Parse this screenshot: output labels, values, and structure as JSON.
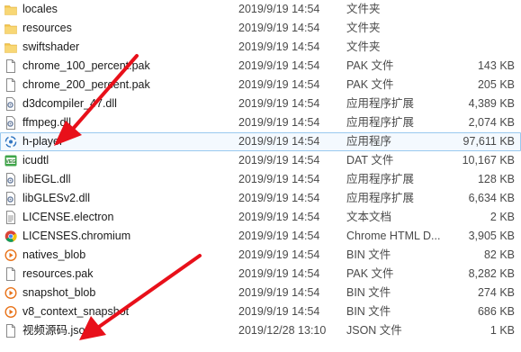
{
  "files": [
    {
      "name": "locales",
      "date": "2019/9/19 14:54",
      "type": "文件夹",
      "size": "",
      "icon": "folder-icon"
    },
    {
      "name": "resources",
      "date": "2019/9/19 14:54",
      "type": "文件夹",
      "size": "",
      "icon": "folder-icon"
    },
    {
      "name": "swiftshader",
      "date": "2019/9/19 14:54",
      "type": "文件夹",
      "size": "",
      "icon": "folder-icon"
    },
    {
      "name": "chrome_100_percent.pak",
      "date": "2019/9/19 14:54",
      "type": "PAK 文件",
      "size": "143 KB",
      "icon": "file-icon"
    },
    {
      "name": "chrome_200_percent.pak",
      "date": "2019/9/19 14:54",
      "type": "PAK 文件",
      "size": "205 KB",
      "icon": "file-icon"
    },
    {
      "name": "d3dcompiler_47.dll",
      "date": "2019/9/19 14:54",
      "type": "应用程序扩展",
      "size": "4,389 KB",
      "icon": "dll-icon"
    },
    {
      "name": "ffmpeg.dll",
      "date": "2019/9/19 14:54",
      "type": "应用程序扩展",
      "size": "2,074 KB",
      "icon": "dll-icon"
    },
    {
      "name": "h-player",
      "date": "2019/9/19 14:54",
      "type": "应用程序",
      "size": "97,611 KB",
      "icon": "app-icon"
    },
    {
      "name": "icudtl",
      "date": "2019/9/19 14:54",
      "type": "DAT 文件",
      "size": "10,167 KB",
      "icon": "dat-icon"
    },
    {
      "name": "libEGL.dll",
      "date": "2019/9/19 14:54",
      "type": "应用程序扩展",
      "size": "128 KB",
      "icon": "dll-icon"
    },
    {
      "name": "libGLESv2.dll",
      "date": "2019/9/19 14:54",
      "type": "应用程序扩展",
      "size": "6,634 KB",
      "icon": "dll-icon"
    },
    {
      "name": "LICENSE.electron",
      "date": "2019/9/19 14:54",
      "type": "文本文档",
      "size": "2 KB",
      "icon": "text-icon"
    },
    {
      "name": "LICENSES.chromium",
      "date": "2019/9/19 14:54",
      "type": "Chrome HTML D...",
      "size": "3,905 KB",
      "icon": "chrome-icon"
    },
    {
      "name": "natives_blob",
      "date": "2019/9/19 14:54",
      "type": "BIN 文件",
      "size": "82 KB",
      "icon": "bin-icon"
    },
    {
      "name": "resources.pak",
      "date": "2019/9/19 14:54",
      "type": "PAK 文件",
      "size": "8,282 KB",
      "icon": "file-icon"
    },
    {
      "name": "snapshot_blob",
      "date": "2019/9/19 14:54",
      "type": "BIN 文件",
      "size": "274 KB",
      "icon": "bin-icon"
    },
    {
      "name": "v8_context_snapshot",
      "date": "2019/9/19 14:54",
      "type": "BIN 文件",
      "size": "686 KB",
      "icon": "bin-icon"
    },
    {
      "name": "视频源码.json",
      "date": "2019/12/28 13:10",
      "type": "JSON 文件",
      "size": "1 KB",
      "icon": "file-icon"
    }
  ],
  "selected_index": 7,
  "colors": {
    "arrow": "#e8101a",
    "folder": "#f3c54b",
    "selection": "#f4f9fe"
  }
}
